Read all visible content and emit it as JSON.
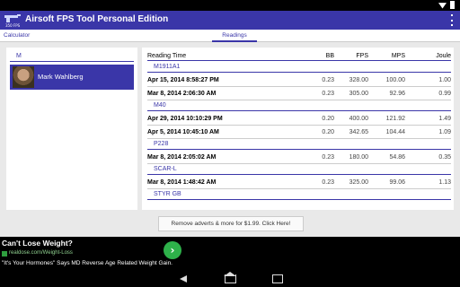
{
  "app": {
    "title": "Airsoft FPS Tool Personal Edition",
    "logo_caption": "350 FPS",
    "accent_color": "#3a36a8"
  },
  "tabs": [
    {
      "label": "Calculator",
      "active": false
    },
    {
      "label": "Readings",
      "active": true
    }
  ],
  "people_list": {
    "header": "M",
    "items": [
      {
        "name": "Mark Wahlberg",
        "selected": true,
        "icon": "avatar-photo"
      }
    ]
  },
  "readings_table": {
    "columns": [
      "Reading Time",
      "BB",
      "FPS",
      "MPS",
      "Joule"
    ],
    "groups": [
      {
        "gun": "M1911A1",
        "rows": [
          {
            "time": "Apr 15, 2014 8:58:27 PM",
            "bb": "0.23",
            "fps": "328.00",
            "mps": "100.00",
            "joule": "1.00"
          },
          {
            "time": "Mar 8, 2014 2:06:30 AM",
            "bb": "0.23",
            "fps": "305.00",
            "mps": "92.96",
            "joule": "0.99"
          }
        ]
      },
      {
        "gun": "M40",
        "rows": [
          {
            "time": "Apr 29, 2014 10:10:29 PM",
            "bb": "0.20",
            "fps": "400.00",
            "mps": "121.92",
            "joule": "1.49"
          },
          {
            "time": "Apr 5, 2014 10:45:10 AM",
            "bb": "0.20",
            "fps": "342.65",
            "mps": "104.44",
            "joule": "1.09"
          }
        ]
      },
      {
        "gun": "P228",
        "rows": [
          {
            "time": "Mar 8, 2014 2:05:02 AM",
            "bb": "0.23",
            "fps": "180.00",
            "mps": "54.86",
            "joule": "0.35"
          }
        ]
      },
      {
        "gun": "SCAR-L",
        "rows": [
          {
            "time": "Mar 8, 2014 1:48:42 AM",
            "bb": "0.23",
            "fps": "325.00",
            "mps": "99.06",
            "joule": "1.13"
          }
        ]
      },
      {
        "gun": "STYR GB",
        "rows": []
      }
    ]
  },
  "remove_ads_button": "Remove adverts & more for $1.99. Click Here!",
  "ad": {
    "title": "Can't Lose Weight?",
    "url": "realdose.com/Weight-Loss",
    "description": "\"It's Your Hormones\" Says MD Reverse Age Related Weight Gain.",
    "arrow_icon": "arrow-right-icon",
    "arrow_color": "#2eb14a"
  },
  "system_nav": [
    "back-icon",
    "home-icon",
    "recent-apps-icon"
  ]
}
